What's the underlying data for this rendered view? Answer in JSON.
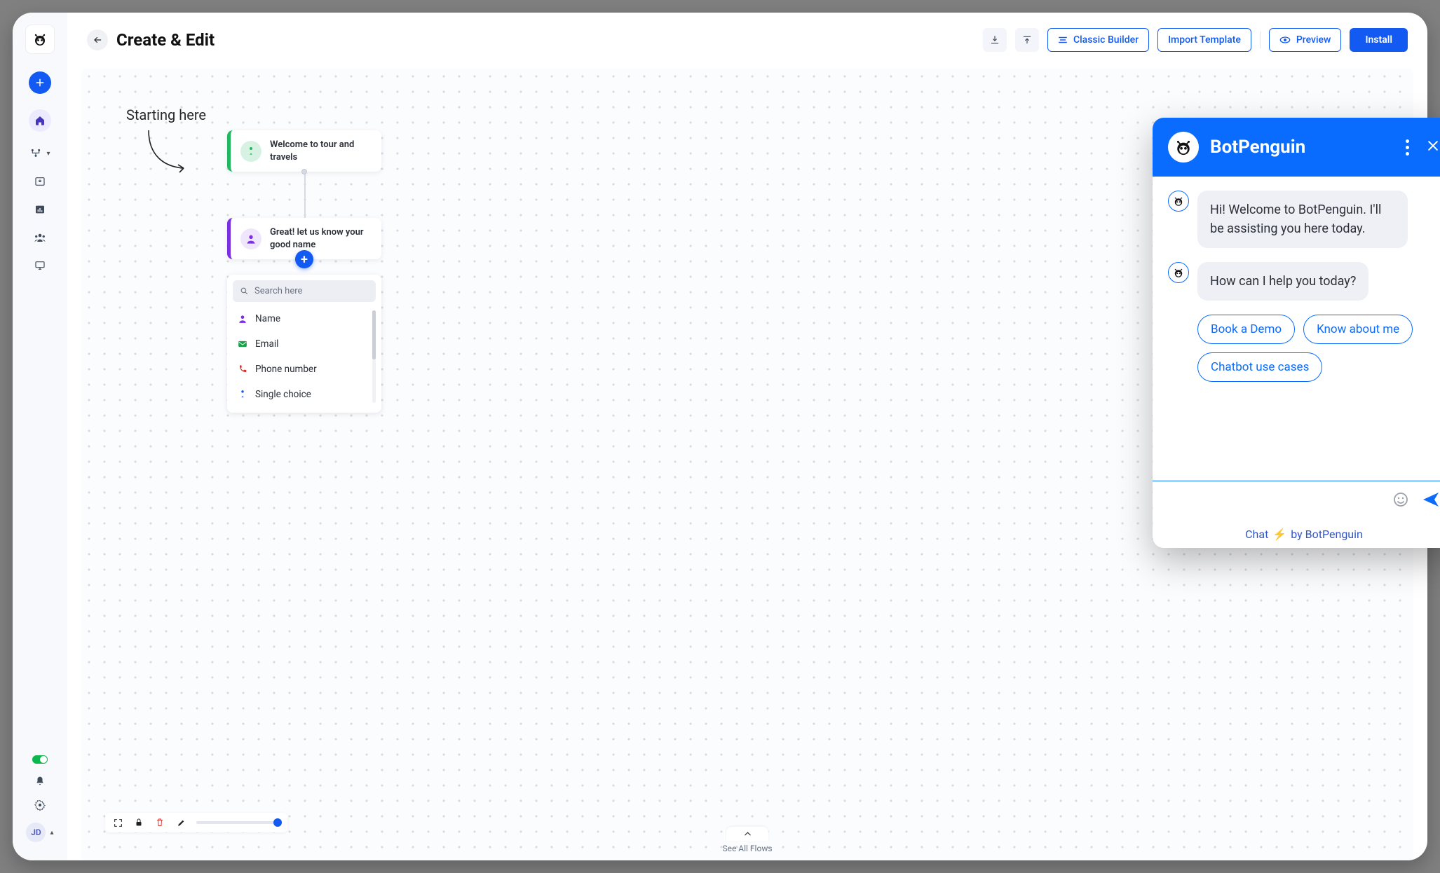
{
  "header": {
    "title": "Create & Edit",
    "classic_builder": "Classic Builder",
    "import_template": "Import Template",
    "preview": "Preview",
    "install": "Install"
  },
  "sidebar": {
    "user_initials": "JD"
  },
  "canvas": {
    "starting_label": "Starting here",
    "node1_text": "Welcome to tour and travels",
    "node2_text": "Great! let us know your good name",
    "search_placeholder": "Search here",
    "picker_options": [
      {
        "icon": "person",
        "label": "Name",
        "color": "#7a2fe0"
      },
      {
        "icon": "mail",
        "label": "Email",
        "color": "#18a04b"
      },
      {
        "icon": "phone",
        "label": "Phone number",
        "color": "#d62f2f"
      },
      {
        "icon": "tap",
        "label": "Single choice",
        "color": "#135af2"
      }
    ],
    "see_all_flows": "See All Flows"
  },
  "chat": {
    "title": "BotPenguin",
    "messages": [
      "Hi! Welcome to BotPenguin. I'll be assisting you here today.",
      "How can I help you today?"
    ],
    "quick_replies": [
      "Book a Demo",
      "Know about me",
      "Chatbot use cases"
    ],
    "footer_prefix": "Chat",
    "footer_suffix": "by BotPenguin"
  }
}
